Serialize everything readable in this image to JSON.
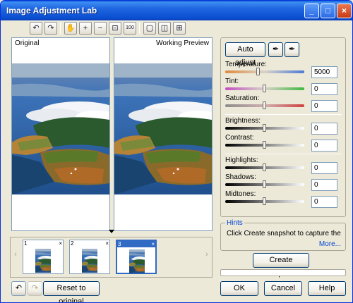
{
  "window": {
    "title": "Image Adjustment Lab"
  },
  "title_buttons": {
    "minimize": "_",
    "maximize": "□",
    "close": "×"
  },
  "toolbar": {
    "tools": [
      {
        "name": "rotate-left-icon",
        "glyph": "↶"
      },
      {
        "name": "rotate-right-icon",
        "glyph": "↷"
      },
      {
        "name": "pan-hand-icon",
        "glyph": "✋"
      },
      {
        "name": "zoom-in-icon",
        "glyph": "+"
      },
      {
        "name": "zoom-out-icon",
        "glyph": "−"
      },
      {
        "name": "zoom-fit-icon",
        "glyph": "⊡"
      },
      {
        "name": "zoom-100-icon",
        "glyph": "100"
      },
      {
        "name": "single-view-icon",
        "glyph": "▢"
      },
      {
        "name": "split-view-icon",
        "glyph": "◫"
      },
      {
        "name": "compare-view-icon",
        "glyph": "⊞"
      }
    ]
  },
  "preview": {
    "original_label": "Original",
    "working_label": "Working Preview"
  },
  "snapshots": [
    {
      "number": "1",
      "close": "×"
    },
    {
      "number": "2",
      "close": "×"
    },
    {
      "number": "3",
      "close": "×"
    }
  ],
  "snap_nav": {
    "left": "‹",
    "right": "›"
  },
  "controls": {
    "auto_adjust": "Auto adjust",
    "temperature": {
      "label": "Temperature:",
      "value": "5000",
      "level": 0.42
    },
    "tint": {
      "label": "Tint:",
      "value": "0",
      "level": 0.5
    },
    "saturation": {
      "label": "Saturation:",
      "value": "0",
      "level": 0.5
    },
    "brightness": {
      "label": "Brightness:",
      "value": "0",
      "level": 0.5
    },
    "contrast": {
      "label": "Contrast:",
      "value": "0",
      "level": 0.5
    },
    "highlights": {
      "label": "Highlights:",
      "value": "0",
      "level": 0.5
    },
    "shadows": {
      "label": "Shadows:",
      "value": "0",
      "level": 0.5
    },
    "midtones": {
      "label": "Midtones:",
      "value": "0",
      "level": 0.5
    }
  },
  "hints": {
    "title": "Hints",
    "text": "Click Create snapshot to capture the",
    "more": "More..."
  },
  "create_snapshot": "Create Snapshot",
  "progress": {
    "level": 0
  },
  "footer": {
    "reset": "Reset to original",
    "ok": "OK",
    "cancel": "Cancel",
    "help": "Help"
  },
  "colors": {
    "selection": "#316ac5",
    "link": "#0046d5",
    "titlebar": "#0a4fd0"
  }
}
